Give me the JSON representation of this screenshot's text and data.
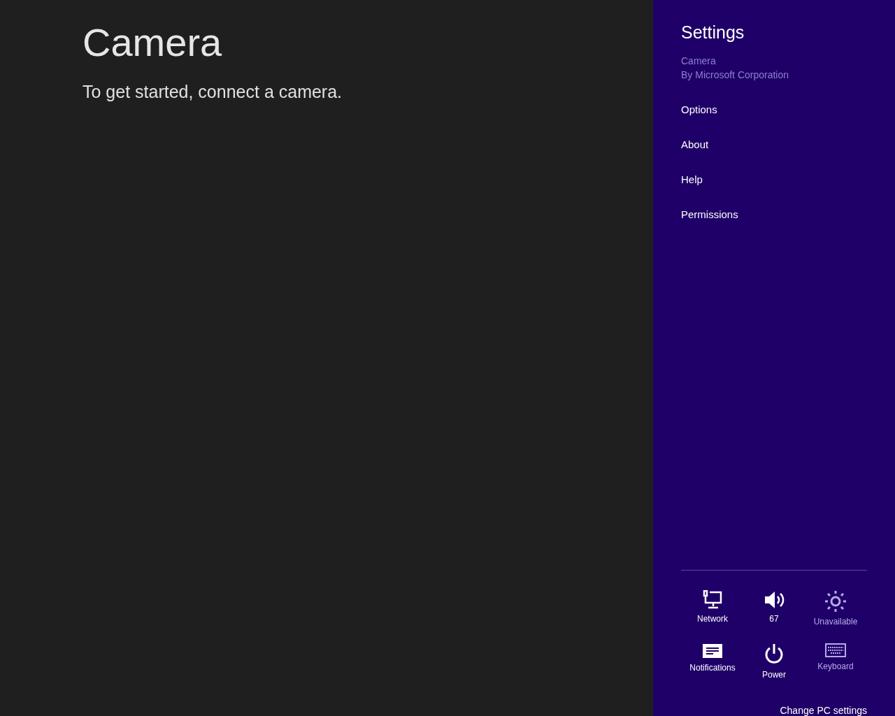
{
  "app": {
    "title": "Camera",
    "message": "To get started, connect a camera."
  },
  "settings": {
    "title": "Settings",
    "app_name": "Camera",
    "publisher": "By Microsoft Corporation",
    "items": [
      "Options",
      "About",
      "Help",
      "Permissions"
    ],
    "tiles": [
      {
        "kind": "network",
        "label": "Network",
        "disabled": false
      },
      {
        "kind": "volume",
        "label": "67",
        "disabled": false
      },
      {
        "kind": "brightness",
        "label": "Unavailable",
        "disabled": true
      },
      {
        "kind": "notifications",
        "label": "Notifications",
        "disabled": false
      },
      {
        "kind": "power",
        "label": "Power",
        "disabled": false
      },
      {
        "kind": "keyboard",
        "label": "Keyboard",
        "disabled": true
      }
    ],
    "footer_link": "Change PC settings"
  }
}
